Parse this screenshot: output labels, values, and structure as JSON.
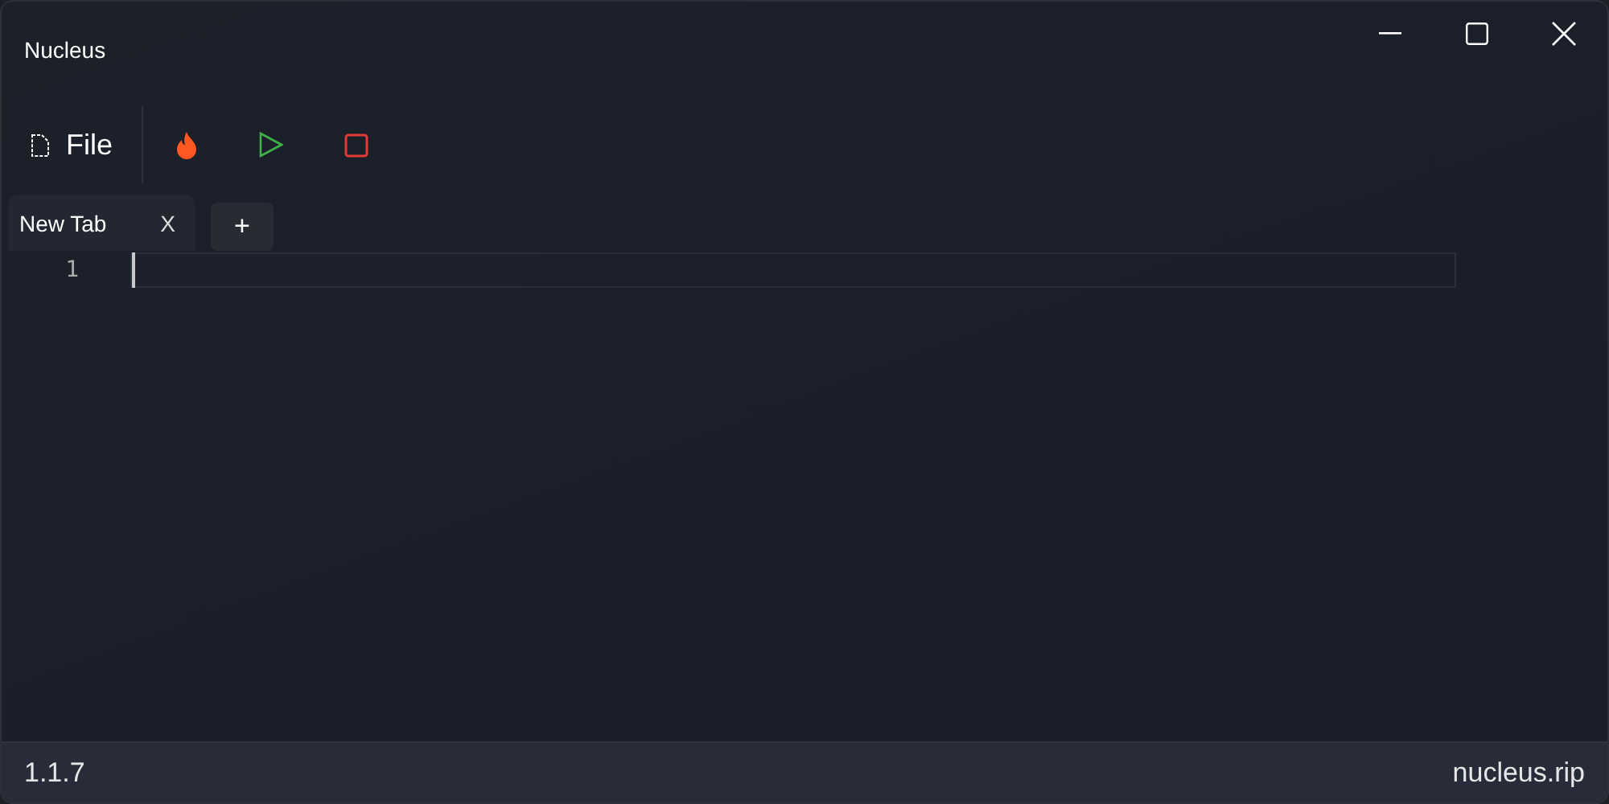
{
  "window": {
    "title": "Nucleus"
  },
  "toolbar": {
    "file_label": "File"
  },
  "tabs": [
    {
      "label": "New Tab",
      "close": "X",
      "selected": true
    }
  ],
  "new_tab": "+",
  "editor": {
    "lines": [
      {
        "number": "1"
      }
    ]
  },
  "status_bar": {
    "version": "1.1.7",
    "site": "nucleus.rip"
  }
}
